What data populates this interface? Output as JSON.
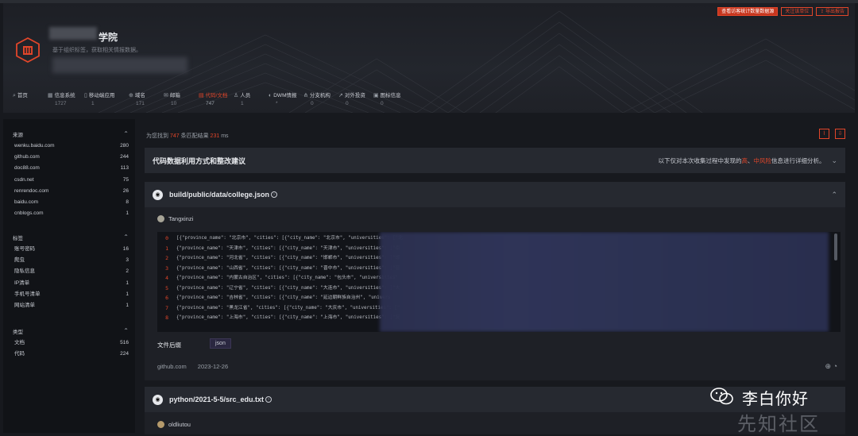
{
  "header": {
    "buttons": [
      {
        "label": "查看访客统计数量数据源",
        "style": "filled"
      },
      {
        "label": "关注该单位",
        "style": "outline"
      },
      {
        "label": "导出报告",
        "style": "outline",
        "icon": "export-icon"
      }
    ],
    "title": "学院",
    "subtitle": "基于组织标签，获取相关情报数据。",
    "nav": [
      {
        "icon": "search-icon",
        "label": "首页",
        "count": "",
        "active": false
      },
      {
        "icon": "system-icon",
        "label": "信息系统",
        "count": "1727",
        "active": false
      },
      {
        "icon": "mobile-icon",
        "label": "移动端应用",
        "count": "1",
        "active": false
      },
      {
        "icon": "domain-icon",
        "label": "域名",
        "count": "171",
        "active": false
      },
      {
        "icon": "mail-icon",
        "label": "邮箱",
        "count": "10",
        "active": false
      },
      {
        "icon": "code-doc-icon",
        "label": "代码/文档",
        "count": "747",
        "active": true
      },
      {
        "icon": "person-icon",
        "label": "人员",
        "count": "1",
        "active": false
      },
      {
        "icon": "dwm-icon",
        "label": "DWM情报",
        "count": "*",
        "active": false
      },
      {
        "icon": "branch-icon",
        "label": "分支机构",
        "count": "0",
        "active": false
      },
      {
        "icon": "investment-icon",
        "label": "对外投资",
        "count": "0",
        "active": false
      },
      {
        "icon": "icon-info-icon",
        "label": "图标信息",
        "count": "0",
        "active": false
      }
    ]
  },
  "sidebar": {
    "groups": [
      {
        "title": "来源",
        "items": [
          {
            "label": "wenku.baidu.com",
            "count": "280"
          },
          {
            "label": "github.com",
            "count": "244"
          },
          {
            "label": "doc88.com",
            "count": "113"
          },
          {
            "label": "csdn.net",
            "count": "75"
          },
          {
            "label": "renrendoc.com",
            "count": "26"
          },
          {
            "label": "baidu.com",
            "count": "8"
          },
          {
            "label": "cnblogs.com",
            "count": "1"
          }
        ]
      },
      {
        "title": "标签",
        "items": [
          {
            "label": "账号密码",
            "count": "16"
          },
          {
            "label": "爬虫",
            "count": "3"
          },
          {
            "label": "隐私信息",
            "count": "2"
          },
          {
            "label": "IP清单",
            "count": "1"
          },
          {
            "label": "手机号清单",
            "count": "1"
          },
          {
            "label": "网站清单",
            "count": "1"
          }
        ]
      },
      {
        "title": "类型",
        "items": [
          {
            "label": "文档",
            "count": "516"
          },
          {
            "label": "代码",
            "count": "224"
          }
        ]
      }
    ]
  },
  "results": {
    "prefix": "为您找到",
    "count": "747",
    "middle": "条匹配结果",
    "time": "231",
    "suffix": "ms"
  },
  "advice": {
    "title": "代码数据利用方式和整改建议",
    "note_prefix": "以下仅对本次收集过程中发现的",
    "note_high": "高",
    "note_sep": "、",
    "note_mid": "中风险",
    "note_suffix": "信息进行详细分析。"
  },
  "file1": {
    "path": "build/public/data/college.json",
    "user": "Tangxinzi",
    "lines": [
      {
        "n": "0",
        "text": "[{\"province_name\": \"北京市\", \"cities\": [{\"city_name\": \"北京市\", \"universities\": [\"北"
      },
      {
        "n": "1",
        "text": "{\"province_name\": \"天津市\", \"cities\": [{\"city_name\": \"天津市\", \"universities\": [\"南"
      },
      {
        "n": "2",
        "text": "{\"province_name\": \"河北省\", \"cities\": [{\"city_name\": \"邯郸市\", \"universities\": [\"邯"
      },
      {
        "n": "3",
        "text": "{\"province_name\": \"山西省\", \"cities\": [{\"city_name\": \"晋中市\", \"universities\": [\"晋"
      },
      {
        "n": "4",
        "text": "{\"province_name\": \"内蒙古自治区\", \"cities\": [{\"city_name\": \"包头市\", \"universities\""
      },
      {
        "n": "5",
        "text": "{\"province_name\": \"辽宁省\", \"cities\": [{\"city_name\": \"大连市\", \"universities\": [\"大"
      },
      {
        "n": "6",
        "text": "{\"province_name\": \"吉林省\", \"cities\": [{\"city_name\": \"延边朝鲜族自治州\", \"univers"
      },
      {
        "n": "7",
        "text": "{\"province_name\": \"黑龙江省\", \"cities\": [{\"city_name\": \"大庆市\", \"universities\": [\""
      },
      {
        "n": "8",
        "text": "{\"province_name\": \"上海市\", \"cities\": [{\"city_name\": \"上海市\", \"universities\": [\"复"
      }
    ],
    "tag_label": "文件后缀",
    "tag": "json",
    "source": "github.com",
    "date": "2023-12-26"
  },
  "file2": {
    "path": "python/2021-5-5/src_edu.txt",
    "user": "oldliutou"
  },
  "watermark": {
    "text": "李白你好",
    "site": "先知社区"
  },
  "colors": {
    "accent": "#e2462a",
    "bg": "#17191e",
    "panel": "#1e2026"
  }
}
